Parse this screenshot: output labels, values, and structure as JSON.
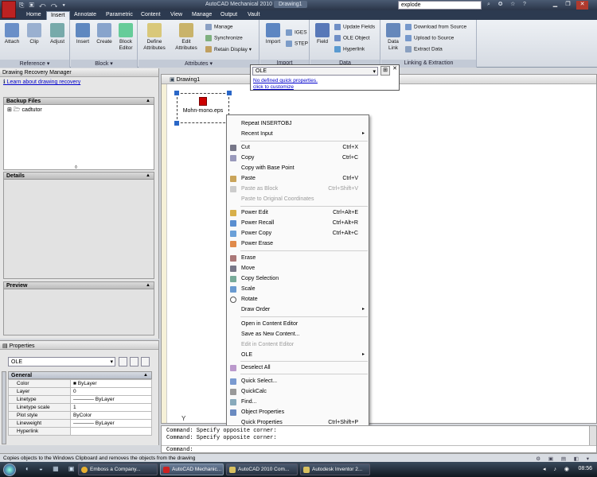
{
  "titlebar": {
    "app_title": "AutoCAD Mechanical 2010",
    "doc_title": "Drawing1",
    "search_value": "explode",
    "qat_icons": "⎘ ▣ ↶ ↷ ▾",
    "toolbar_icons": "⌕ ✪ ☆ ?"
  },
  "tabs": [
    "Home",
    "Insert",
    "Annotate",
    "Parametric",
    "Content",
    "View",
    "Manage",
    "Output",
    "Vault"
  ],
  "ribbon": {
    "reference": {
      "title": "Reference",
      "buttons": [
        "Attach",
        "Clip",
        "Adjust"
      ]
    },
    "block": {
      "title": "Block",
      "buttons": [
        "Insert",
        "Create",
        "Block\nEditor"
      ]
    },
    "attributes": {
      "title": "Attributes",
      "define": "Define\nAttributes",
      "edit": "Edit\nAttributes",
      "manage": "Manage",
      "synchronize": "Synchronize",
      "retain": "Retain Display"
    },
    "import": {
      "title": "Import",
      "import": "Import",
      "iges": "IGES",
      "step": "STEP"
    },
    "data": {
      "title": "Data",
      "field": "Field",
      "update_fields": "Update Fields",
      "ole_object": "OLE Object",
      "hyperlink": "Hyperlink"
    },
    "linking": {
      "title": "Linking & Extraction",
      "data_link": "Data\nLink",
      "download": "Download from Source",
      "upload": "Upload to Source",
      "extract": "Extract  Data"
    }
  },
  "recovery": {
    "title": "Drawing Recovery Manager",
    "learn_link": "Learn about drawing recovery",
    "backup_title": "Backup Files",
    "backup_item": "cadtutor",
    "details_title": "Details",
    "preview_title": "Preview"
  },
  "properties": {
    "title": "Properties",
    "selected": "OLE",
    "group": "General",
    "rows": [
      {
        "k": "Color",
        "v": "■ ByLayer"
      },
      {
        "k": "Layer",
        "v": "0"
      },
      {
        "k": "Linetype",
        "v": "———— ByLayer"
      },
      {
        "k": "Linetype scale",
        "v": "1"
      },
      {
        "k": "Plot style",
        "v": "ByColor"
      },
      {
        "k": "Lineweight",
        "v": "———— ByLayer"
      },
      {
        "k": "Hyperlink",
        "v": ""
      }
    ]
  },
  "drawing": {
    "tab": "Drawing1",
    "object_label": "Mohn-mono.eps",
    "ucs": "Y"
  },
  "quick_props": {
    "selected": "OLE",
    "line1": "No defined quick properties.",
    "line2": "click to customize"
  },
  "context_menu": {
    "items": [
      {
        "label": "Repeat INSERTOBJ",
        "sc": "",
        "sub": false,
        "dis": false
      },
      {
        "label": "Recent Input",
        "sc": "",
        "sub": true,
        "dis": false
      },
      {
        "label": "Cut",
        "sc": "Ctrl+X",
        "sub": false,
        "dis": false
      },
      {
        "label": "Copy",
        "sc": "Ctrl+C",
        "sub": false,
        "dis": false
      },
      {
        "label": "Copy with Base Point",
        "sc": "",
        "sub": false,
        "dis": false
      },
      {
        "label": "Paste",
        "sc": "Ctrl+V",
        "sub": false,
        "dis": false
      },
      {
        "label": "Paste as Block",
        "sc": "Ctrl+Shift+V",
        "sub": false,
        "dis": true
      },
      {
        "label": "Paste to Original Coordinates",
        "sc": "",
        "sub": false,
        "dis": true
      },
      {
        "label": "Power Edit",
        "sc": "Ctrl+Alt+E",
        "sub": false,
        "dis": false
      },
      {
        "label": "Power Recall",
        "sc": "Ctrl+Alt+R",
        "sub": false,
        "dis": false
      },
      {
        "label": "Power Copy",
        "sc": "Ctrl+Alt+C",
        "sub": false,
        "dis": false
      },
      {
        "label": "Power Erase",
        "sc": "",
        "sub": false,
        "dis": false
      },
      {
        "label": "Erase",
        "sc": "",
        "sub": false,
        "dis": false
      },
      {
        "label": "Move",
        "sc": "",
        "sub": false,
        "dis": false
      },
      {
        "label": "Copy Selection",
        "sc": "",
        "sub": false,
        "dis": false
      },
      {
        "label": "Scale",
        "sc": "",
        "sub": false,
        "dis": false
      },
      {
        "label": "Rotate",
        "sc": "",
        "sub": false,
        "dis": false
      },
      {
        "label": "Draw Order",
        "sc": "",
        "sub": true,
        "dis": false
      },
      {
        "label": "Open in Content Editor",
        "sc": "",
        "sub": false,
        "dis": false
      },
      {
        "label": "Save as New Content...",
        "sc": "",
        "sub": false,
        "dis": false
      },
      {
        "label": "Edit in Content Editor",
        "sc": "",
        "sub": false,
        "dis": true
      },
      {
        "label": "OLE",
        "sc": "",
        "sub": true,
        "dis": false
      },
      {
        "label": "Deselect All",
        "sc": "",
        "sub": false,
        "dis": false
      },
      {
        "label": "Quick Select...",
        "sc": "",
        "sub": false,
        "dis": false
      },
      {
        "label": "QuickCalc",
        "sc": "",
        "sub": false,
        "dis": false
      },
      {
        "label": "Find...",
        "sc": "",
        "sub": false,
        "dis": false
      },
      {
        "label": "Object Properties",
        "sc": "",
        "sub": false,
        "dis": false
      },
      {
        "label": "Quick Properties",
        "sc": "Ctrl+Shift+P",
        "sub": false,
        "dis": false
      }
    ]
  },
  "command": {
    "line1": "Command: Specify opposite corner:",
    "line2": "Command: Specify opposite corner:",
    "prompt": "Command:"
  },
  "status": {
    "message": "Copies objects to the Windows Clipboard and removes the objects from the drawing",
    "icons": "⚙ ▣ ▤ ◧ ▾"
  },
  "taskbar": {
    "quick_launch": "◐ ◒ ▦ ▣",
    "tasks": [
      "Emboss a Company...",
      "AutoCAD Mechanic...",
      "AutoCAD 2010 Com...",
      "Autodesk Inventor 2..."
    ],
    "tray_icons": "◂ ♪ ◉",
    "clock": "08:56"
  }
}
